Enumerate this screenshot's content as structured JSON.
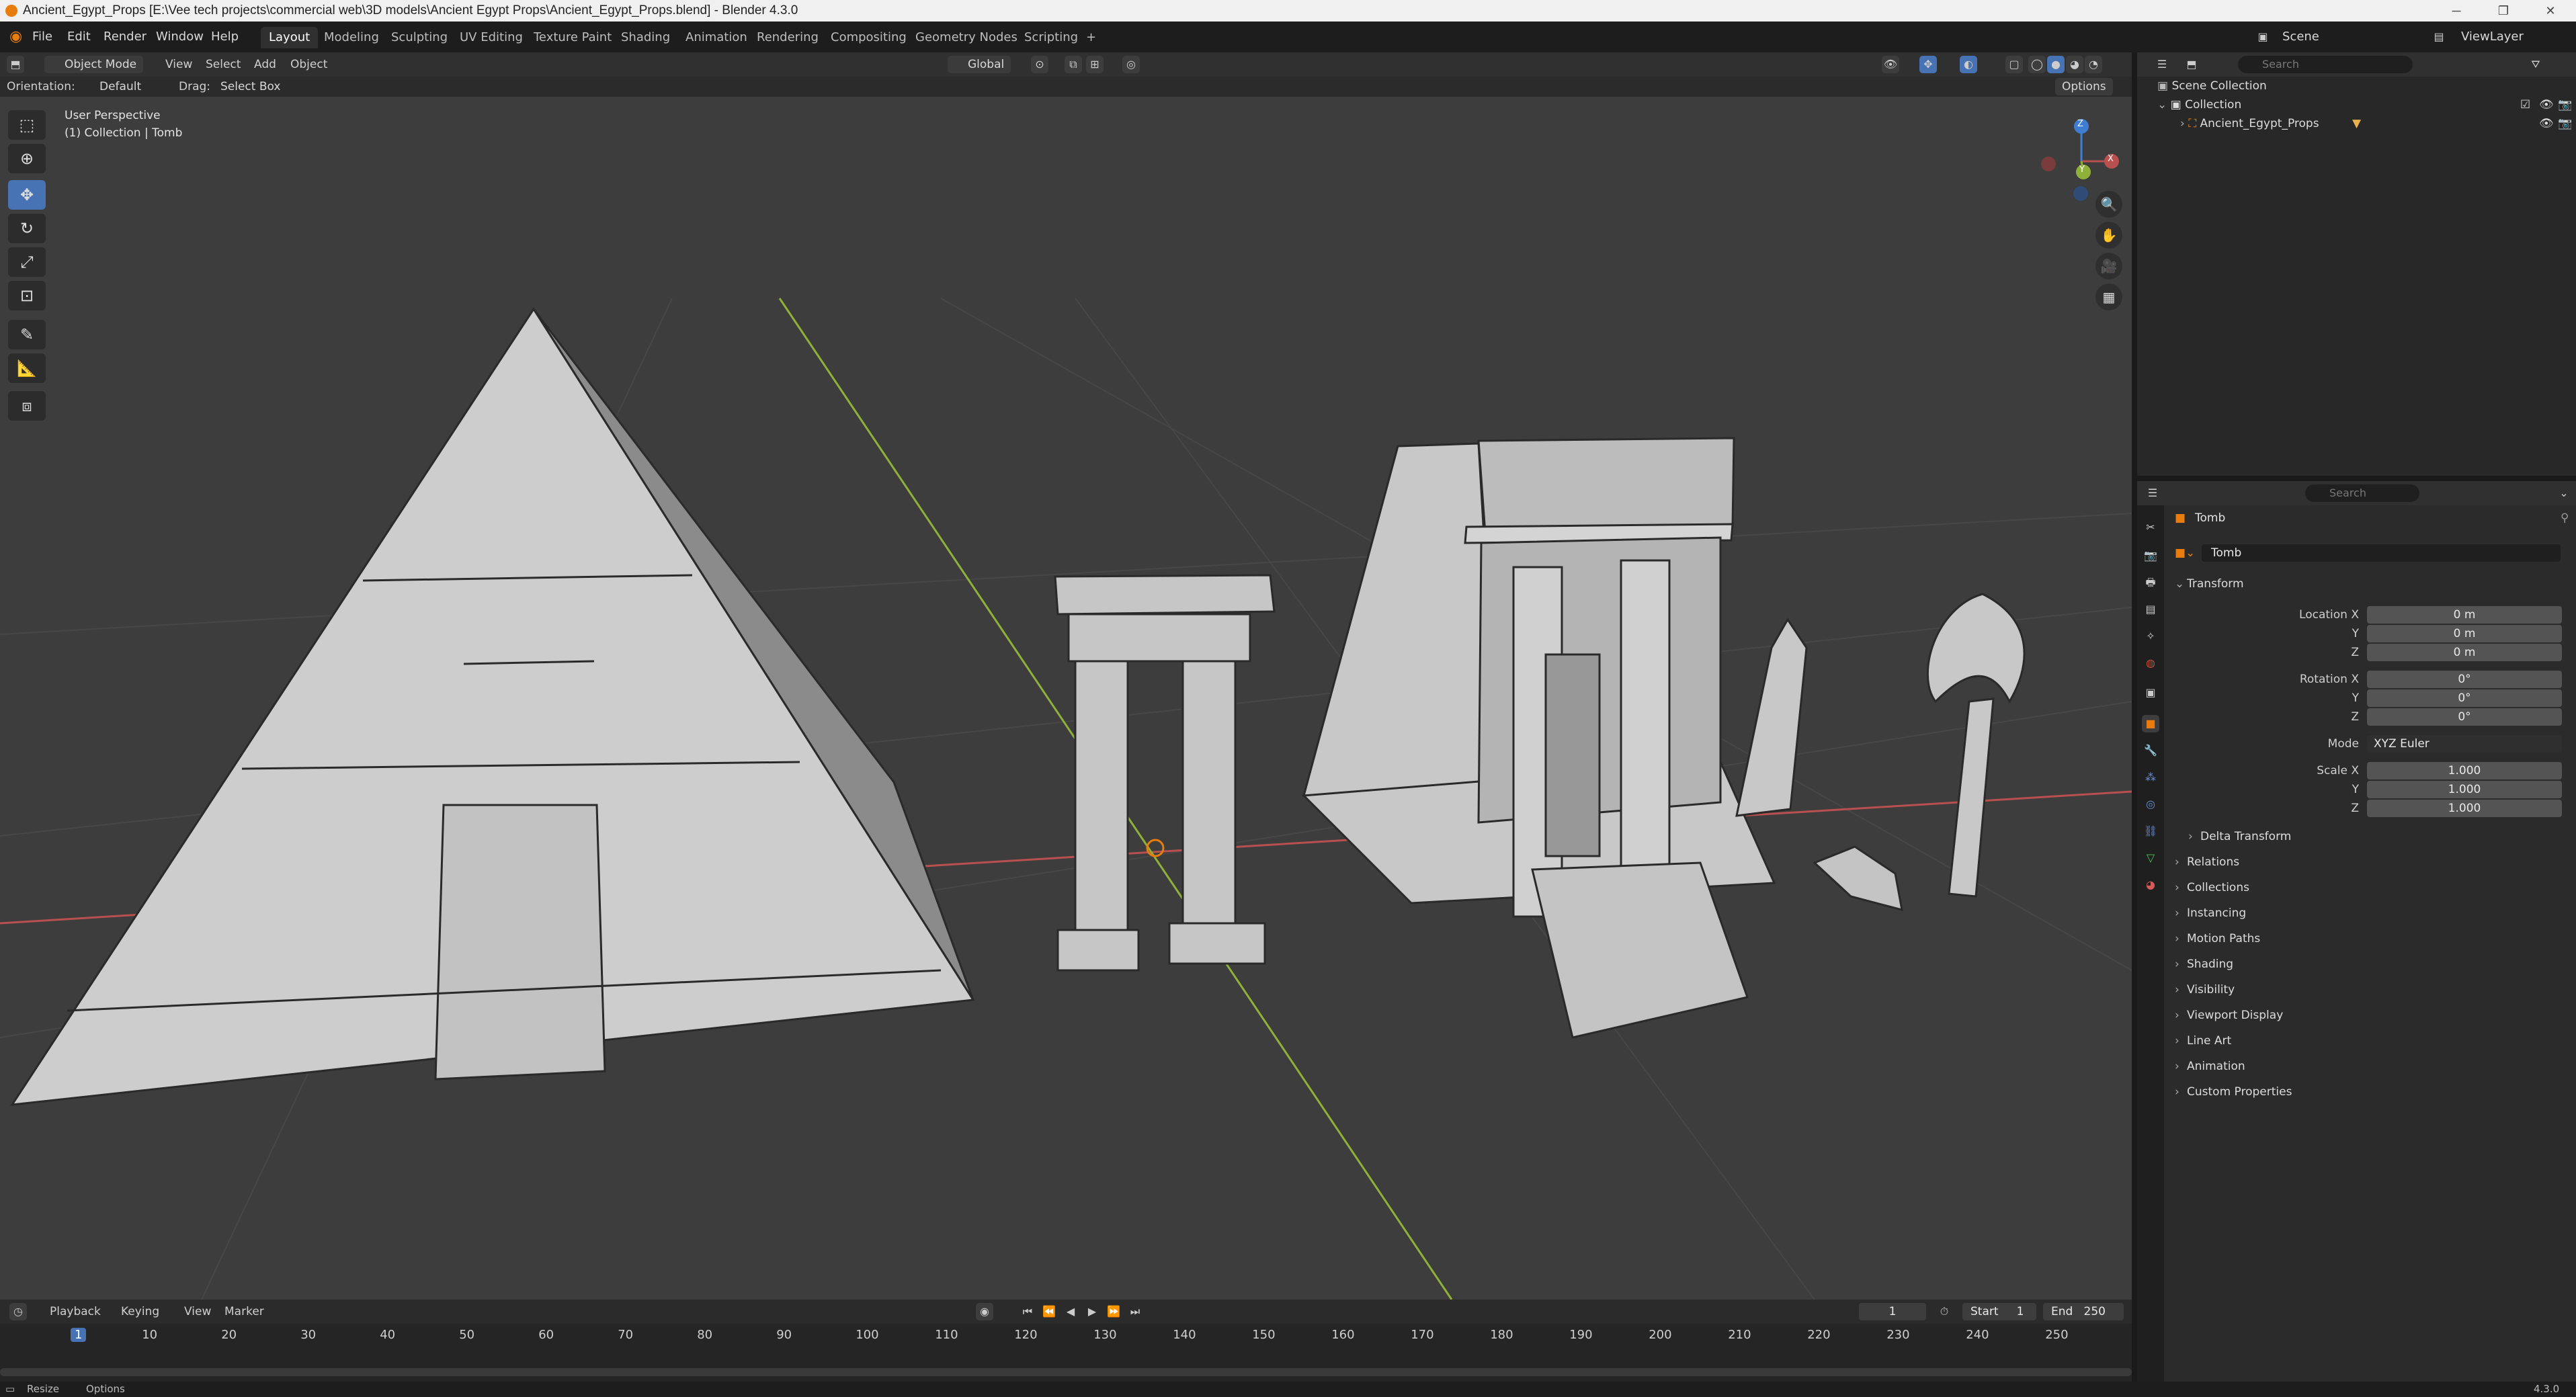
{
  "window": {
    "title": "Ancient_Egypt_Props [E:\\Vee tech projects\\commercial web\\3D models\\Ancient Egypt Props\\Ancient_Egypt_Props.blend] - Blender 4.3.0",
    "minimize": "─",
    "maximize": "❐",
    "close": "✕"
  },
  "menu": [
    "File",
    "Edit",
    "Render",
    "Window",
    "Help"
  ],
  "workspaces": [
    "Layout",
    "Modeling",
    "Sculpting",
    "UV Editing",
    "Texture Paint",
    "Shading",
    "Animation",
    "Rendering",
    "Compositing",
    "Geometry Nodes",
    "Scripting"
  ],
  "workspace_add": "+",
  "active_workspace": "Layout",
  "scene": {
    "label": "Scene",
    "view_layer": "ViewLayer"
  },
  "viewport_header": {
    "mode": "Object Mode",
    "menus": [
      "View",
      "Select",
      "Add",
      "Object"
    ],
    "transform_orientation": "Global",
    "options": "Options"
  },
  "tool_settings": {
    "orientation_label": "Orientation:",
    "orientation_value": "Default",
    "drag_label": "Drag:",
    "drag_value": "Select Box"
  },
  "overlay": {
    "view_name": "User Perspective",
    "context": "(1) Collection | Tomb"
  },
  "gizmo": {
    "x": "X",
    "y": "Y",
    "z": "Z"
  },
  "timeline": {
    "menus": [
      "Playback",
      "Keying",
      "View",
      "Marker"
    ],
    "current_frame": "1",
    "start_label": "Start",
    "start": "1",
    "end_label": "End",
    "end": "250",
    "ticks": [
      "1",
      "10",
      "20",
      "30",
      "40",
      "50",
      "60",
      "70",
      "80",
      "90",
      "100",
      "110",
      "120",
      "130",
      "140",
      "150",
      "160",
      "170",
      "180",
      "190",
      "200",
      "210",
      "220",
      "230",
      "240",
      "250"
    ]
  },
  "statusbar": {
    "left": [
      "Resize",
      "Options"
    ],
    "version": "4.3.0"
  },
  "outliner": {
    "search_placeholder": "Search",
    "items": [
      {
        "label": "Scene Collection"
      },
      {
        "label": "Collection"
      },
      {
        "label": "Ancient_Egypt_Props"
      }
    ]
  },
  "properties": {
    "search_placeholder": "Search",
    "object_name": "Tomb",
    "datablock_name": "Tomb",
    "transform_label": "Transform",
    "location": {
      "label": "Location X",
      "x": "0 m",
      "y": "0 m",
      "z": "0 m"
    },
    "rotation": {
      "label": "Rotation X",
      "x": "0°",
      "y": "0°",
      "z": "0°"
    },
    "mode": {
      "label": "Mode",
      "value": "XYZ Euler"
    },
    "scale": {
      "label": "Scale X",
      "x": "1.000",
      "y": "1.000",
      "z": "1.000"
    },
    "axis_y": "Y",
    "axis_z": "Z",
    "panels": [
      "Delta Transform",
      "Relations",
      "Collections",
      "Instancing",
      "Motion Paths",
      "Shading",
      "Visibility",
      "Viewport Display",
      "Line Art",
      "Animation",
      "Custom Properties"
    ]
  },
  "colors": {
    "accent": "#4772b3",
    "axis_x": "#b8504f",
    "axis_y": "#8fb13a",
    "axis_z": "#3e7dd1",
    "origin": "#e87d0d"
  }
}
